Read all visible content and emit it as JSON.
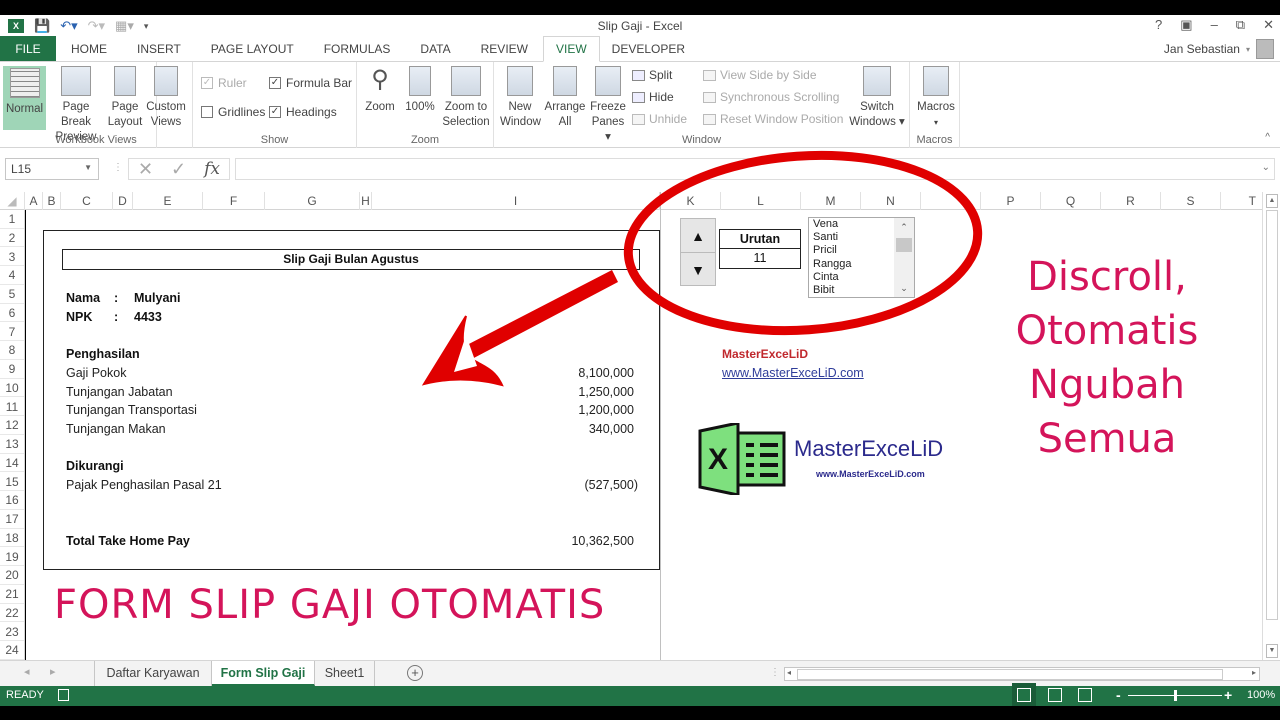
{
  "app": {
    "window_title": "Slip Gaji - Excel",
    "user_name": "Jan Sebastian",
    "window_controls": [
      "?",
      "ribbon-display-options",
      "minimize",
      "restore",
      "close"
    ]
  },
  "quick_access": {
    "icons": [
      "excel-icon",
      "save-icon",
      "undo-icon",
      "redo-icon",
      "touch-mode-icon",
      "customize-icon"
    ]
  },
  "ribbon_tabs": [
    {
      "label": "FILE"
    },
    {
      "label": "HOME"
    },
    {
      "label": "INSERT"
    },
    {
      "label": "PAGE LAYOUT"
    },
    {
      "label": "FORMULAS"
    },
    {
      "label": "DATA"
    },
    {
      "label": "REVIEW"
    },
    {
      "label": "VIEW",
      "active": true
    },
    {
      "label": "DEVELOPER"
    }
  ],
  "ribbon": {
    "workbook_views": {
      "label": "Workbook Views",
      "normal": "Normal",
      "page_break_1": "Page Break",
      "page_break_2": "Preview",
      "page_layout_1": "Page",
      "page_layout_2": "Layout",
      "custom_1": "Custom",
      "custom_2": "Views"
    },
    "show": {
      "label": "Show",
      "ruler": {
        "label": "Ruler",
        "checked": true,
        "disabled": true
      },
      "formula_bar": {
        "label": "Formula Bar",
        "checked": true
      },
      "gridlines": {
        "label": "Gridlines",
        "checked": false
      },
      "headings": {
        "label": "Headings",
        "checked": true
      }
    },
    "zoom": {
      "label": "Zoom",
      "zoom": "Zoom",
      "hundred": "100%",
      "zoom_sel_1": "Zoom to",
      "zoom_sel_2": "Selection"
    },
    "window": {
      "label": "Window",
      "new_1": "New",
      "new_2": "Window",
      "arrange_1": "Arrange",
      "arrange_2": "All",
      "freeze_1": "Freeze",
      "freeze_2": "Panes ▾",
      "split": "Split",
      "hide": "Hide",
      "unhide": "Unhide",
      "side_by_side": "View Side by Side",
      "sync_scroll": "Synchronous Scrolling",
      "reset_pos": "Reset Window Position",
      "switch_1": "Switch",
      "switch_2": "Windows ▾"
    },
    "macros": {
      "label": "Macros",
      "btn": "Macros",
      "arrow": "▾"
    }
  },
  "formula_bar": {
    "name_box": "L15",
    "formula": ""
  },
  "columns": [
    "A",
    "B",
    "C",
    "D",
    "E",
    "F",
    "G",
    "H",
    "I",
    "K",
    "L",
    "M",
    "N",
    "P",
    "Q",
    "R",
    "S",
    "T"
  ],
  "rows": [
    "1",
    "2",
    "3",
    "4",
    "5",
    "6",
    "7",
    "8",
    "9",
    "10",
    "11",
    "12",
    "13",
    "14",
    "15",
    "16",
    "17",
    "18",
    "19",
    "20",
    "21",
    "22",
    "23",
    "24"
  ],
  "slip": {
    "title": "Slip Gaji Bulan Agustus",
    "nama_label": "Nama",
    "colon": ":",
    "nama_value": "Mulyani",
    "npk_label": "NPK",
    "npk_value": "4433",
    "penghasilan_header": "Penghasilan",
    "earnings": [
      {
        "label": "Gaji Pokok",
        "value": "8,100,000"
      },
      {
        "label": "Tunjangan Jabatan",
        "value": "1,250,000"
      },
      {
        "label": "Tunjangan Transportasi",
        "value": "1,200,000"
      },
      {
        "label": "Tunjangan Makan",
        "value": "340,000"
      }
    ],
    "dikurangi_header": "Dikurangi",
    "deductions": [
      {
        "label": "Pajak Penghasilan Pasal 21",
        "value": "(527,500)"
      }
    ],
    "total_label": "Total Take Home Pay",
    "total_value": "10,362,500"
  },
  "controls": {
    "urutan_label": "Urutan",
    "urutan_value": "11",
    "list_items": [
      "Vena",
      "Santi",
      "Pricil",
      "Rangga",
      "Cinta",
      "Bibit"
    ]
  },
  "branding": {
    "name": "MasterExceLiD",
    "url": "www.MasterExceLiD.com",
    "logo_name": "MasterExceLiD",
    "logo_url": "www.MasterExceLiD.com"
  },
  "overlay": {
    "banner": "FORM SLIP GAJI OTOMATIS",
    "side_text": [
      "Discroll,",
      "Otomatis",
      "Ngubah",
      "Semua"
    ],
    "accent_color": "#d4145a",
    "annotation_color": "#e00000"
  },
  "sheet_tabs": [
    {
      "label": "Daftar Karyawan"
    },
    {
      "label": "Form Slip Gaji",
      "active": true
    },
    {
      "label": "Sheet1"
    }
  ],
  "status": {
    "mode": "READY",
    "zoom": "100%",
    "zoom_fraction": 0.5
  }
}
